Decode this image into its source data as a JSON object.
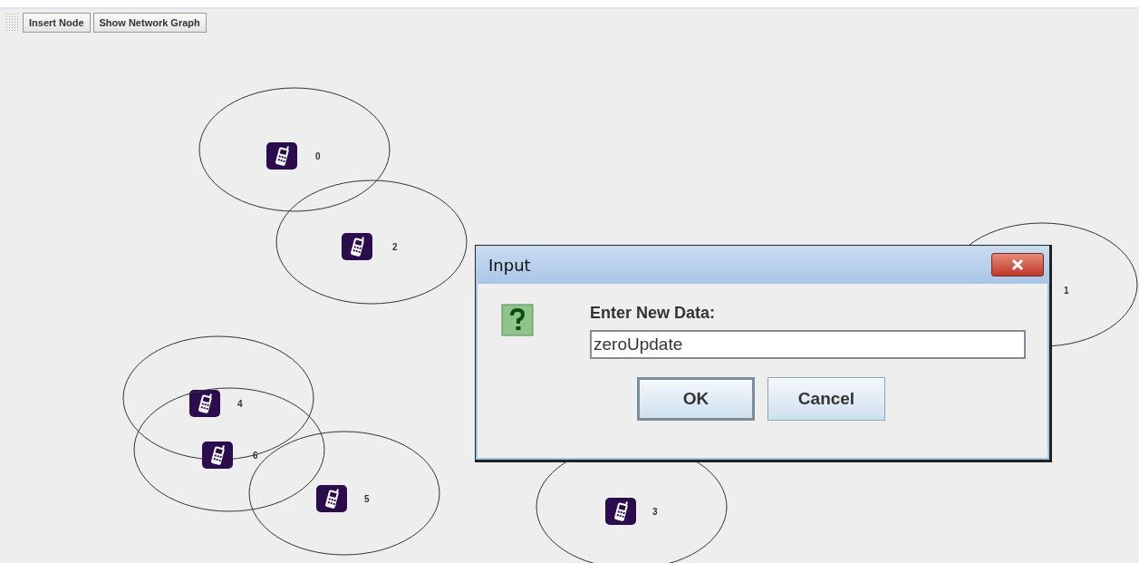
{
  "toolbar": {
    "buttons": [
      "Insert Node",
      "Show Network Graph"
    ]
  },
  "nodes": [
    {
      "label": "0"
    },
    {
      "label": "2"
    },
    {
      "label": "1"
    },
    {
      "label": "4"
    },
    {
      "label": "6"
    },
    {
      "label": "5"
    },
    {
      "label": "3"
    }
  ],
  "dialog": {
    "title": "Input",
    "prompt": "Enter New Data:",
    "value": "zeroUpdate",
    "buttons": [
      "OK",
      "Cancel"
    ]
  }
}
